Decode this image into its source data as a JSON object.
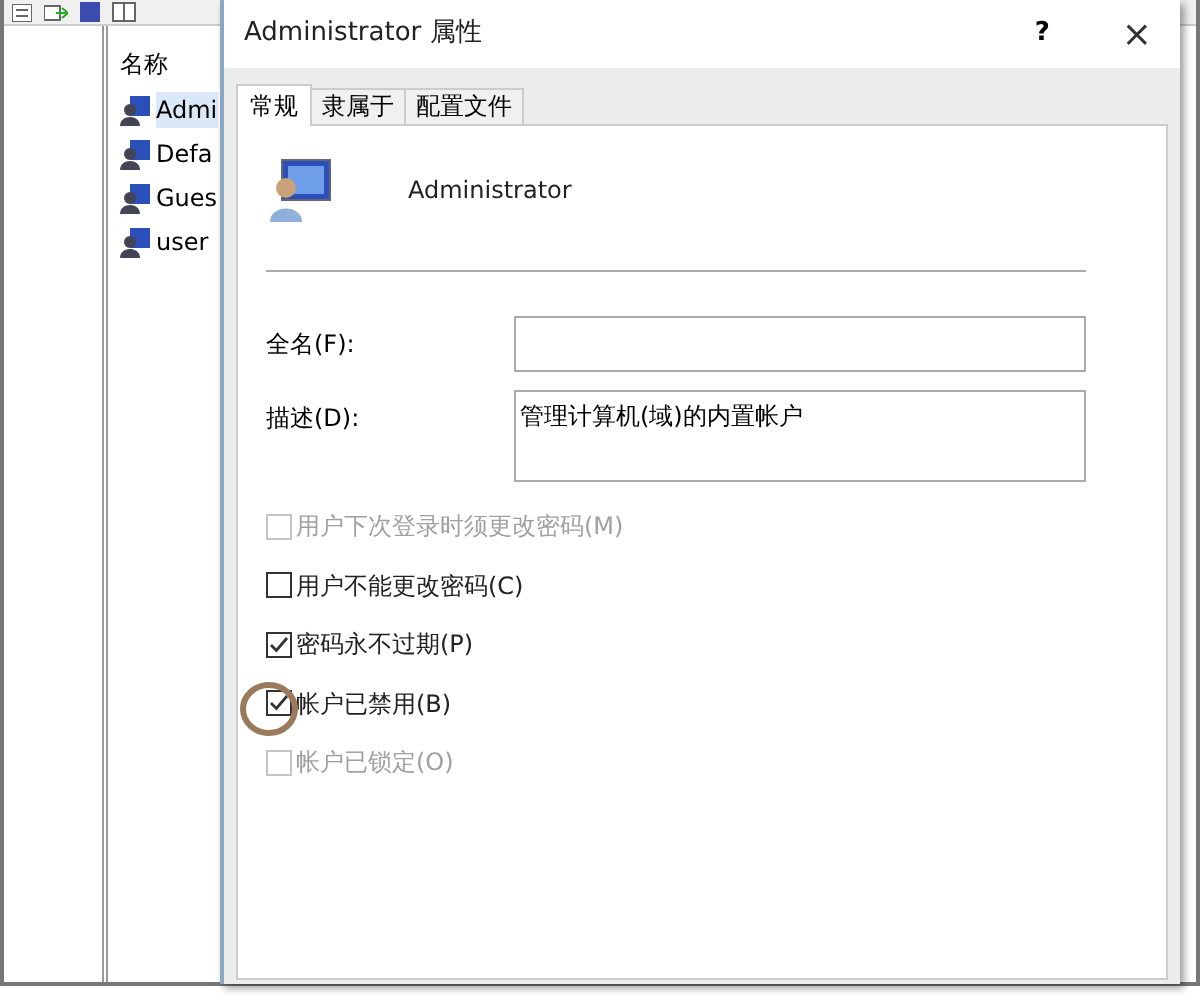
{
  "background_window": {
    "column_header": "名称",
    "items": [
      {
        "label": "Admi",
        "selected": true
      },
      {
        "label": "Defa",
        "selected": false
      },
      {
        "label": "Gues",
        "selected": false
      },
      {
        "label": "user",
        "selected": false
      }
    ]
  },
  "dialog": {
    "title": "Administrator 属性",
    "help": "?",
    "close": "×",
    "tabs": [
      {
        "label": "常规",
        "selected": true
      },
      {
        "label": "隶属于",
        "selected": false
      },
      {
        "label": "配置文件",
        "selected": false
      }
    ],
    "user_name": "Administrator",
    "fields": [
      {
        "label": "全名(F):",
        "kind": "line"
      },
      {
        "label": "描述(D):",
        "kind": "area",
        "value": "管理计算机(域)的内置帐户"
      }
    ],
    "checkboxes": [
      {
        "label": "用户下次登录时须更改密码(M)",
        "checked": false,
        "disabled": true
      },
      {
        "label": "用户不能更改密码(C)",
        "checked": false,
        "disabled": false
      },
      {
        "label": "密码永不过期(P)",
        "checked": true,
        "disabled": false
      },
      {
        "label": "帐户已禁用(B)",
        "checked": true,
        "disabled": false
      },
      {
        "label": "帐户已锁定(O)",
        "checked": false,
        "disabled": true
      }
    ]
  }
}
